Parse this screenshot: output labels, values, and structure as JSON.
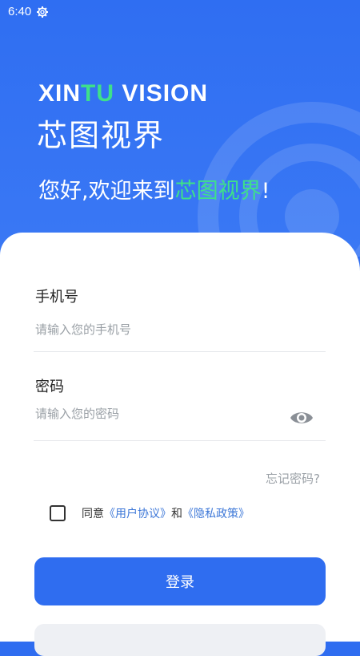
{
  "status_bar": {
    "time": "6:40"
  },
  "hero": {
    "brand_en_part1": "XIN",
    "brand_en_part2": "TU",
    "brand_en_part3": " VISION",
    "brand_cn": "芯图视界",
    "welcome_prefix": "您好,欢迎来到",
    "welcome_highlight": "芯图视界",
    "welcome_suffix": "!"
  },
  "form": {
    "phone_label": "手机号",
    "phone_placeholder": "请输入您的手机号",
    "password_label": "密码",
    "password_placeholder": "请输入您的密码",
    "forgot_label": "忘记密码?",
    "agree_prefix": "同意",
    "user_agreement": "《用户协议》",
    "agree_and": "和",
    "privacy_policy": "《隐私政策》",
    "login_label": "登录"
  },
  "colors": {
    "primary": "#2f6df0",
    "accent": "#3ee08a",
    "link": "#3e78d8"
  },
  "icons": {
    "status": "gear-icon",
    "password_toggle": "eye-icon"
  }
}
